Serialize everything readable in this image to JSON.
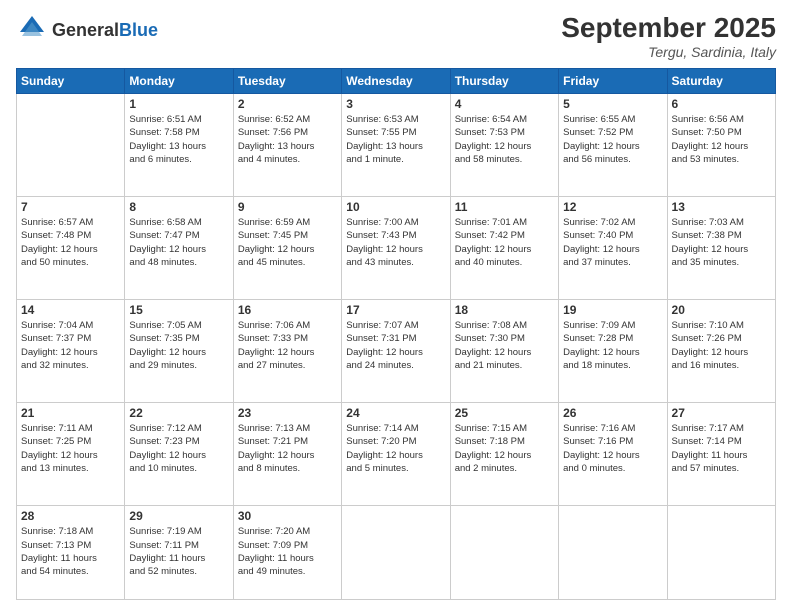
{
  "header": {
    "logo_general": "General",
    "logo_blue": "Blue",
    "month_title": "September 2025",
    "location": "Tergu, Sardinia, Italy"
  },
  "days_of_week": [
    "Sunday",
    "Monday",
    "Tuesday",
    "Wednesday",
    "Thursday",
    "Friday",
    "Saturday"
  ],
  "weeks": [
    [
      {
        "day": "",
        "info": ""
      },
      {
        "day": "1",
        "info": "Sunrise: 6:51 AM\nSunset: 7:58 PM\nDaylight: 13 hours\nand 6 minutes."
      },
      {
        "day": "2",
        "info": "Sunrise: 6:52 AM\nSunset: 7:56 PM\nDaylight: 13 hours\nand 4 minutes."
      },
      {
        "day": "3",
        "info": "Sunrise: 6:53 AM\nSunset: 7:55 PM\nDaylight: 13 hours\nand 1 minute."
      },
      {
        "day": "4",
        "info": "Sunrise: 6:54 AM\nSunset: 7:53 PM\nDaylight: 12 hours\nand 58 minutes."
      },
      {
        "day": "5",
        "info": "Sunrise: 6:55 AM\nSunset: 7:52 PM\nDaylight: 12 hours\nand 56 minutes."
      },
      {
        "day": "6",
        "info": "Sunrise: 6:56 AM\nSunset: 7:50 PM\nDaylight: 12 hours\nand 53 minutes."
      }
    ],
    [
      {
        "day": "7",
        "info": "Sunrise: 6:57 AM\nSunset: 7:48 PM\nDaylight: 12 hours\nand 50 minutes."
      },
      {
        "day": "8",
        "info": "Sunrise: 6:58 AM\nSunset: 7:47 PM\nDaylight: 12 hours\nand 48 minutes."
      },
      {
        "day": "9",
        "info": "Sunrise: 6:59 AM\nSunset: 7:45 PM\nDaylight: 12 hours\nand 45 minutes."
      },
      {
        "day": "10",
        "info": "Sunrise: 7:00 AM\nSunset: 7:43 PM\nDaylight: 12 hours\nand 43 minutes."
      },
      {
        "day": "11",
        "info": "Sunrise: 7:01 AM\nSunset: 7:42 PM\nDaylight: 12 hours\nand 40 minutes."
      },
      {
        "day": "12",
        "info": "Sunrise: 7:02 AM\nSunset: 7:40 PM\nDaylight: 12 hours\nand 37 minutes."
      },
      {
        "day": "13",
        "info": "Sunrise: 7:03 AM\nSunset: 7:38 PM\nDaylight: 12 hours\nand 35 minutes."
      }
    ],
    [
      {
        "day": "14",
        "info": "Sunrise: 7:04 AM\nSunset: 7:37 PM\nDaylight: 12 hours\nand 32 minutes."
      },
      {
        "day": "15",
        "info": "Sunrise: 7:05 AM\nSunset: 7:35 PM\nDaylight: 12 hours\nand 29 minutes."
      },
      {
        "day": "16",
        "info": "Sunrise: 7:06 AM\nSunset: 7:33 PM\nDaylight: 12 hours\nand 27 minutes."
      },
      {
        "day": "17",
        "info": "Sunrise: 7:07 AM\nSunset: 7:31 PM\nDaylight: 12 hours\nand 24 minutes."
      },
      {
        "day": "18",
        "info": "Sunrise: 7:08 AM\nSunset: 7:30 PM\nDaylight: 12 hours\nand 21 minutes."
      },
      {
        "day": "19",
        "info": "Sunrise: 7:09 AM\nSunset: 7:28 PM\nDaylight: 12 hours\nand 18 minutes."
      },
      {
        "day": "20",
        "info": "Sunrise: 7:10 AM\nSunset: 7:26 PM\nDaylight: 12 hours\nand 16 minutes."
      }
    ],
    [
      {
        "day": "21",
        "info": "Sunrise: 7:11 AM\nSunset: 7:25 PM\nDaylight: 12 hours\nand 13 minutes."
      },
      {
        "day": "22",
        "info": "Sunrise: 7:12 AM\nSunset: 7:23 PM\nDaylight: 12 hours\nand 10 minutes."
      },
      {
        "day": "23",
        "info": "Sunrise: 7:13 AM\nSunset: 7:21 PM\nDaylight: 12 hours\nand 8 minutes."
      },
      {
        "day": "24",
        "info": "Sunrise: 7:14 AM\nSunset: 7:20 PM\nDaylight: 12 hours\nand 5 minutes."
      },
      {
        "day": "25",
        "info": "Sunrise: 7:15 AM\nSunset: 7:18 PM\nDaylight: 12 hours\nand 2 minutes."
      },
      {
        "day": "26",
        "info": "Sunrise: 7:16 AM\nSunset: 7:16 PM\nDaylight: 12 hours\nand 0 minutes."
      },
      {
        "day": "27",
        "info": "Sunrise: 7:17 AM\nSunset: 7:14 PM\nDaylight: 11 hours\nand 57 minutes."
      }
    ],
    [
      {
        "day": "28",
        "info": "Sunrise: 7:18 AM\nSunset: 7:13 PM\nDaylight: 11 hours\nand 54 minutes."
      },
      {
        "day": "29",
        "info": "Sunrise: 7:19 AM\nSunset: 7:11 PM\nDaylight: 11 hours\nand 52 minutes."
      },
      {
        "day": "30",
        "info": "Sunrise: 7:20 AM\nSunset: 7:09 PM\nDaylight: 11 hours\nand 49 minutes."
      },
      {
        "day": "",
        "info": ""
      },
      {
        "day": "",
        "info": ""
      },
      {
        "day": "",
        "info": ""
      },
      {
        "day": "",
        "info": ""
      }
    ]
  ]
}
